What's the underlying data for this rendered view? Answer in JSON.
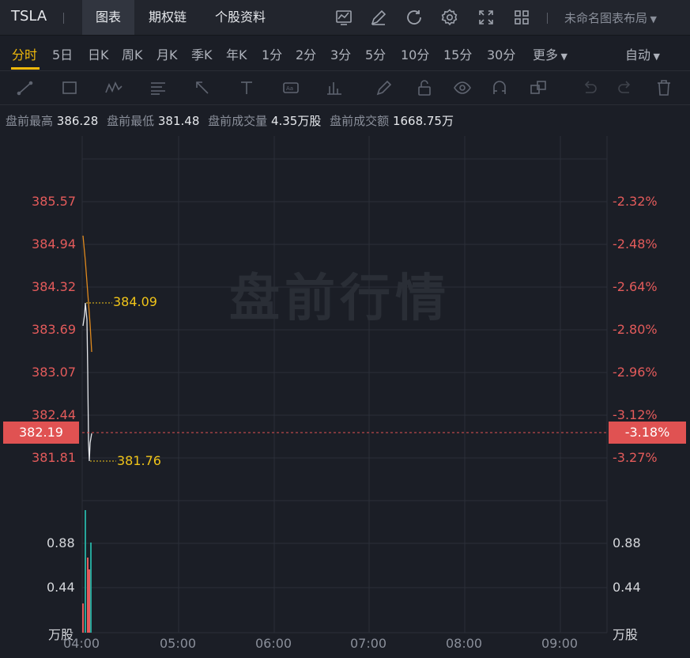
{
  "topbar": {
    "symbol": "TSLA",
    "tabs": [
      "图表",
      "期权链",
      "个股资料"
    ],
    "layout_label": "未命名图表布局"
  },
  "periods": {
    "items": [
      "分时",
      "5日",
      "日K",
      "周K",
      "月K",
      "季K",
      "年K",
      "1分",
      "2分",
      "3分",
      "5分",
      "10分",
      "15分",
      "30分",
      "更多"
    ],
    "active": "分时",
    "auto_label": "自动"
  },
  "info": {
    "high_label": "盘前最高",
    "high": "386.28",
    "low_label": "盘前最低",
    "low": "381.48",
    "vol_label": "盘前成交量",
    "vol": "4.35万股",
    "amt_label": "盘前成交额",
    "amt": "1668.75万"
  },
  "watermark": "盘前行情",
  "price_axis": [
    "385.57",
    "384.94",
    "384.32",
    "383.69",
    "383.07",
    "382.44",
    "381.81"
  ],
  "pct_axis": [
    "-2.32%",
    "-2.48%",
    "-2.64%",
    "-2.80%",
    "-2.96%",
    "-3.12%",
    "-3.27%"
  ],
  "current": {
    "price": "382.19",
    "pct": "-3.18%"
  },
  "annotations": {
    "high": "384.09",
    "low": "381.76"
  },
  "volume_axis": {
    "left": [
      "0.88",
      "0.44",
      "万股"
    ],
    "right": [
      "0.88",
      "0.44",
      "万股"
    ]
  },
  "time_axis": [
    "04:00",
    "05:00",
    "06:00",
    "07:00",
    "08:00",
    "09:00"
  ],
  "colors": {
    "up": "#e45b5b",
    "down": "#26a69a",
    "accent": "#f0b90b",
    "annot": "#f0c419"
  }
}
